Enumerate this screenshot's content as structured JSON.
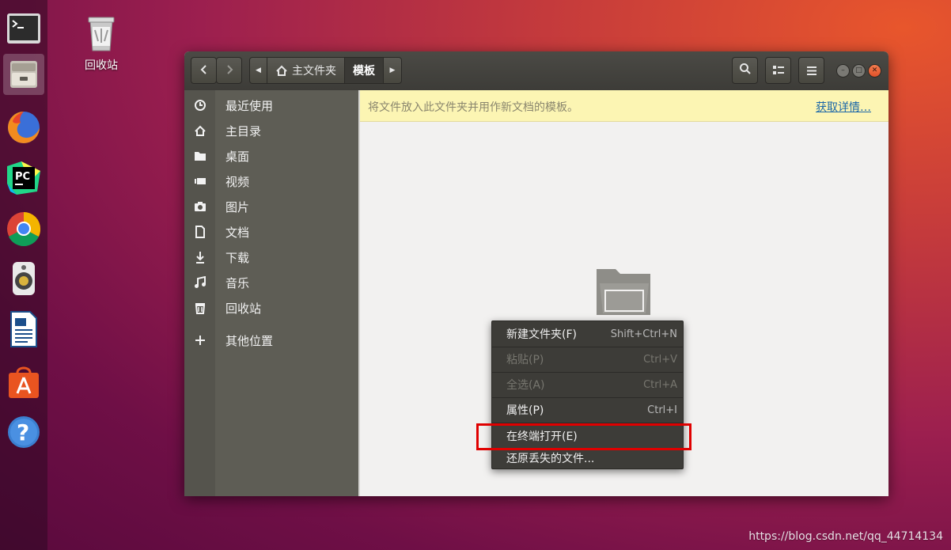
{
  "desktop": {
    "trash_label": "回收站",
    "watermark": "https://blog.csdn.net/qq_44714134"
  },
  "dock": {
    "items": [
      {
        "name": "terminal",
        "icon": "terminal-icon"
      },
      {
        "name": "files",
        "icon": "file-manager-icon",
        "active": true
      },
      {
        "name": "firefox",
        "icon": "firefox-icon"
      },
      {
        "name": "pycharm",
        "icon": "pycharm-icon",
        "text": "PC"
      },
      {
        "name": "chrome",
        "icon": "chrome-icon"
      },
      {
        "name": "rhythmbox",
        "icon": "speaker-icon"
      },
      {
        "name": "writer",
        "icon": "writer-icon"
      },
      {
        "name": "software",
        "icon": "software-center-icon"
      },
      {
        "name": "help",
        "icon": "help-icon",
        "text": "?"
      }
    ]
  },
  "window": {
    "breadcrumb": {
      "home_label": "主文件夹",
      "current_label": "模板"
    },
    "infobar": {
      "message": "将文件放入此文件夹并用作新文档的模板。",
      "link": "获取详情…"
    },
    "sidebar": {
      "items": [
        {
          "label": "最近使用",
          "icon": "clock-icon"
        },
        {
          "label": "主目录",
          "icon": "home-icon"
        },
        {
          "label": "桌面",
          "icon": "folder-icon"
        },
        {
          "label": "视频",
          "icon": "video-icon"
        },
        {
          "label": "图片",
          "icon": "camera-icon"
        },
        {
          "label": "文档",
          "icon": "document-icon"
        },
        {
          "label": "下载",
          "icon": "download-icon"
        },
        {
          "label": "音乐",
          "icon": "music-icon"
        },
        {
          "label": "回收站",
          "icon": "trash-icon"
        },
        {
          "label": "其他位置",
          "icon": "plus-icon"
        }
      ]
    }
  },
  "context_menu": {
    "items": [
      {
        "label": "新建文件夹(F)",
        "accel": "Shift+Ctrl+N",
        "enabled": true
      },
      {
        "label": "粘贴(P)",
        "accel": "Ctrl+V",
        "enabled": false
      },
      {
        "label": "全选(A)",
        "accel": "Ctrl+A",
        "enabled": false
      },
      {
        "label": "属性(P)",
        "accel": "Ctrl+I",
        "enabled": true
      },
      {
        "label": "在终端打开(E)",
        "accel": "",
        "enabled": true
      },
      {
        "label": "还原丢失的文件...",
        "accel": "",
        "enabled": true
      }
    ],
    "highlight_color": "#e00000"
  }
}
